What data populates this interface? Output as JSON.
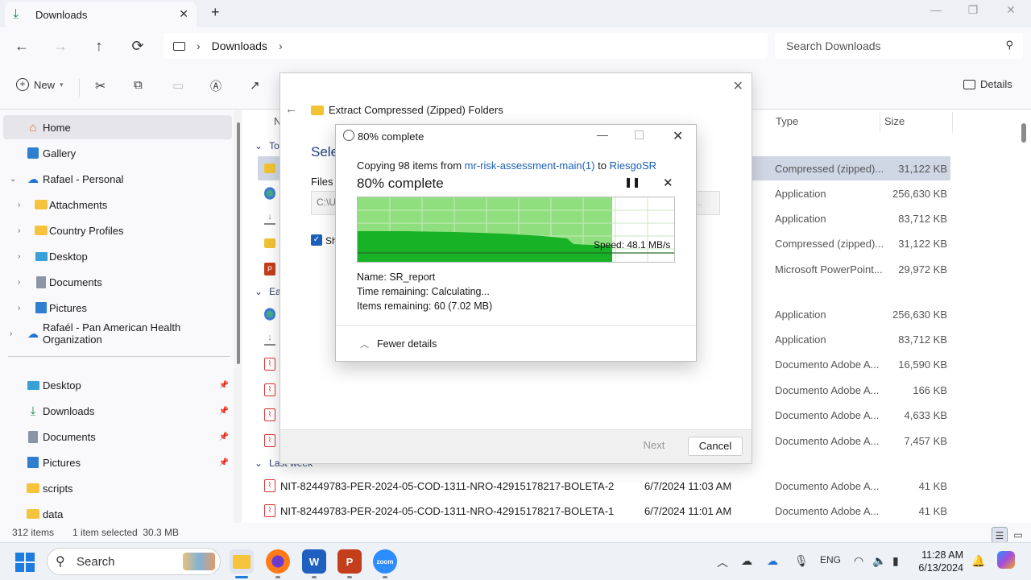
{
  "window": {
    "tab_title": "Downloads",
    "new_tab": "+",
    "tab_close": "✕"
  },
  "address": {
    "back": "←",
    "forward": "→",
    "up": "↑",
    "refresh": "⟳",
    "crumbs": [
      "Downloads"
    ],
    "search_placeholder": "Search Downloads"
  },
  "commandbar": {
    "new_label": "New",
    "details_label": "Details"
  },
  "sidebar": {
    "items": [
      {
        "label": "Home",
        "icon": "home-icon"
      },
      {
        "label": "Gallery",
        "icon": "gallery-icon"
      },
      {
        "label": "Rafael - Personal",
        "icon": "onedrive-icon"
      },
      {
        "label": "Attachments",
        "icon": "folder-icon"
      },
      {
        "label": "Country Profiles",
        "icon": "folder-icon"
      },
      {
        "label": "Desktop",
        "icon": "desktop-icon"
      },
      {
        "label": "Documents",
        "icon": "documents-icon"
      },
      {
        "label": "Pictures",
        "icon": "pictures-icon"
      },
      {
        "label": "Rafaél - Pan American Health Organization",
        "icon": "onedrive-icon"
      }
    ],
    "quick": [
      {
        "label": "Desktop",
        "icon": "desktop-icon"
      },
      {
        "label": "Downloads",
        "icon": "downloads-icon"
      },
      {
        "label": "Documents",
        "icon": "documents-icon"
      },
      {
        "label": "Pictures",
        "icon": "pictures-icon"
      },
      {
        "label": "scripts",
        "icon": "folder-icon"
      },
      {
        "label": "data",
        "icon": "folder-icon"
      }
    ]
  },
  "content": {
    "columns": {
      "name": "N",
      "type": "Type",
      "size": "Size"
    },
    "groups": {
      "today": "Tod",
      "earlier": "Ear",
      "last_week": "Last week"
    },
    "rows_top": [
      {
        "type": "Compressed (zipped)...",
        "size": "31,122 KB",
        "icon": "zip-icon"
      },
      {
        "type": "Application",
        "size": "256,630 KB",
        "icon": "app-icon"
      },
      {
        "type": "Application",
        "size": "83,712 KB",
        "icon": "download-icon"
      },
      {
        "type": "Compressed (zipped)...",
        "size": "31,122 KB",
        "icon": "zip-icon"
      },
      {
        "type": "Microsoft PowerPoint...",
        "size": "29,972 KB",
        "icon": "ppt-icon"
      }
    ],
    "rows_earlier": [
      {
        "type": "Application",
        "size": "256,630 KB",
        "icon": "app-icon"
      },
      {
        "type": "Application",
        "size": "83,712 KB",
        "icon": "download-icon"
      },
      {
        "type": "Documento Adobe A...",
        "size": "16,590 KB",
        "icon": "pdf-icon"
      },
      {
        "type": "Documento Adobe A...",
        "size": "166 KB",
        "icon": "pdf-icon"
      },
      {
        "type": "Documento Adobe A...",
        "size": "4,633 KB",
        "icon": "pdf-icon"
      },
      {
        "type": "Documento Adobe A...",
        "size": "7,457 KB",
        "icon": "pdf-icon"
      }
    ],
    "rows_lastweek": [
      {
        "name": "NIT-82449783-PER-2024-05-COD-1311-NRO-42915178217-BOLETA-2",
        "date": "6/7/2024 11:03 AM",
        "type": "Documento Adobe A...",
        "size": "41 KB"
      },
      {
        "name": "NIT-82449783-PER-2024-05-COD-1311-NRO-42915178217-BOLETA-1",
        "date": "6/7/2024 11:01 AM",
        "type": "Documento Adobe A...",
        "size": "41 KB"
      }
    ]
  },
  "status": {
    "items": "312 items",
    "selected": "1 item selected  30.3 MB"
  },
  "wizard": {
    "title": "Extract Compressed (Zipped) Folders",
    "heading": "Sele",
    "files_label": "Files w",
    "path": "C:\\U",
    "path_tail": "e...",
    "checkbox_label": "Sho",
    "next": "Next",
    "cancel": "Cancel"
  },
  "progress": {
    "title": "80% complete",
    "copy_prefix": "Copying 98 items from ",
    "source": "mr-risk-assessment-main(1)",
    "copy_mid": " to ",
    "dest": "RiesgoSR",
    "percent_label": "80% complete",
    "percent": 80,
    "speed": "Speed: 48.1 MB/s",
    "name_label": "Name:",
    "name_value": "SR_report",
    "time_label": "Time remaining:",
    "time_value": "Calculating...",
    "items_label": "Items remaining:",
    "items_value": "60 (7.02 MB)",
    "fewer": "Fewer details"
  },
  "taskbar": {
    "search_label": "Search",
    "lang": "ENG",
    "time": "11:28 AM",
    "date": "6/13/2024"
  }
}
